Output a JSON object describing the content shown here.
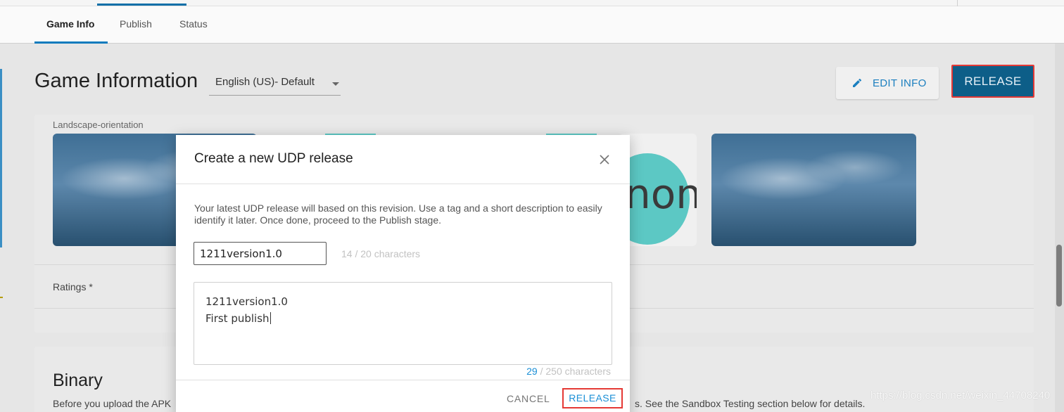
{
  "tabs": [
    {
      "label": "Game Info",
      "active": true
    },
    {
      "label": "Publish",
      "active": false
    },
    {
      "label": "Status",
      "active": false
    }
  ],
  "header": {
    "title": "Game Information",
    "language": "English (US)- Default",
    "edit_label": "EDIT INFO",
    "release_label": "RELEASE"
  },
  "media": {
    "label": "Landscape-orientation",
    "logo_text": "non"
  },
  "ratings": {
    "label": "Ratings *"
  },
  "binary": {
    "title": "Binary",
    "desc_left": "Before you upload the APK",
    "desc_right": "s. See the Sandbox Testing section below for details."
  },
  "modal": {
    "title": "Create a new UDP release",
    "description": "Your latest UDP release will based on this revision. Use a tag and a short description to easily identify it later. Once done, proceed to the Publish stage.",
    "tag_value": "1211version1.0",
    "tag_count": "14 / 20 characters",
    "desc_line1": "1211version1.0",
    "desc_line2": "First publish",
    "desc_count_value": "29",
    "desc_count_suffix": " / 250 characters",
    "cancel_label": "CANCEL",
    "release_label": "RELEASE"
  },
  "watermark": "https://blog.csdn.net/weixin_44708240",
  "colors": {
    "accent": "#1b8fd6",
    "primary_dark": "#0d5e88",
    "highlight_border": "#e53935"
  }
}
